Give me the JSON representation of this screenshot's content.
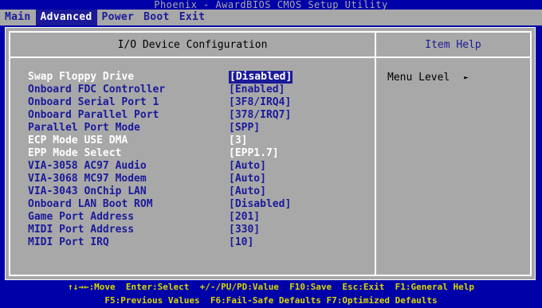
{
  "title": "Phoenix - AwardBIOS CMOS Setup Utility",
  "menu": [
    {
      "label": "Main"
    },
    {
      "label": "Advanced"
    },
    {
      "label": "Power"
    },
    {
      "label": "Boot"
    },
    {
      "label": "Exit"
    }
  ],
  "main_pane": {
    "header": "I/O Device Configuration"
  },
  "help_pane": {
    "header": "Item Help",
    "menu_level_label": "Menu Level",
    "menu_level_arrow": "►"
  },
  "settings": [
    {
      "label": "Swap Floppy Drive",
      "value": "[Disabled]"
    },
    {
      "label": "Onboard FDC Controller",
      "value": "[Enabled]"
    },
    {
      "label": "Onboard Serial Port 1",
      "value": "[3F8/IRQ4]"
    },
    {
      "label": "Onboard Parallel Port",
      "value": "[378/IRQ7]"
    },
    {
      "label": "Parallel Port Mode",
      "value": "[SPP]"
    },
    {
      "label": "ECP Mode USE DMA",
      "value": "[3]"
    },
    {
      "label": "EPP Mode Select",
      "value": "[EPP1.7]"
    },
    {
      "label": "VIA-3058 AC97 Audio",
      "value": "[Auto]"
    },
    {
      "label": "VIA-3068 MC97 Modem",
      "value": "[Auto]"
    },
    {
      "label": "VIA-3043 OnChip LAN",
      "value": "[Auto]"
    },
    {
      "label": "Onboard LAN Boot ROM",
      "value": "[Disabled]"
    },
    {
      "label": "Game Port Address",
      "value": "[201]"
    },
    {
      "label": "MIDI Port Address",
      "value": "[330]"
    },
    {
      "label": "MIDI Port IRQ",
      "value": "[10]"
    }
  ],
  "footer": {
    "line1": "↑↓→←:Move  Enter:Select  +/-/PU/PD:Value  F10:Save  Esc:Exit  F1:General Help",
    "line2": "F5:Previous Values  F6:Fail-Safe Defaults F7:Optimized Defaults"
  },
  "colors": {
    "background": "#0000a8",
    "panel": "#a8a8a8",
    "text_blue": "#1a1a9a",
    "footer_yellow": "#d8d800"
  }
}
